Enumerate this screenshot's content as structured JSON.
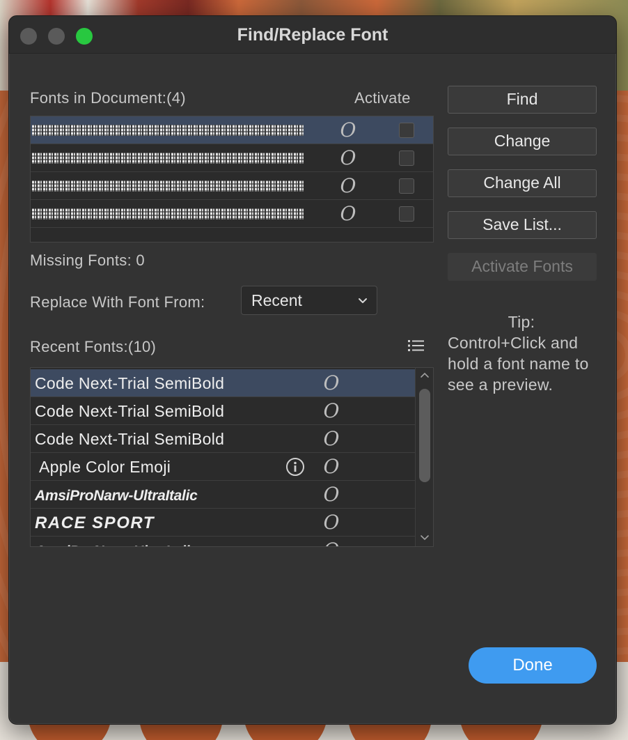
{
  "window": {
    "title": "Find/Replace Font"
  },
  "fonts_in_document": {
    "label": "Fonts in Document:(4)",
    "activate_label": "Activate",
    "rows": [
      {
        "selected": true,
        "icon": "opentype-icon",
        "checked": false
      },
      {
        "selected": false,
        "icon": "opentype-icon",
        "checked": false
      },
      {
        "selected": false,
        "icon": "opentype-icon",
        "checked": false
      },
      {
        "selected": false,
        "icon": "opentype-icon",
        "checked": false
      }
    ]
  },
  "missing_fonts": {
    "label": "Missing Fonts: 0"
  },
  "replace_with": {
    "label": "Replace With Font From:",
    "selected": "Recent"
  },
  "recent_fonts": {
    "label": "Recent Fonts:(10)",
    "rows": [
      {
        "name": "Code Next-Trial SemiBold",
        "selected": true,
        "icon": "opentype-icon"
      },
      {
        "name": "Code Next-Trial SemiBold",
        "selected": false,
        "icon": "opentype-icon"
      },
      {
        "name": "Code Next-Trial SemiBold",
        "selected": false,
        "icon": "opentype-icon"
      },
      {
        "name": "Apple Color Emoji",
        "selected": false,
        "icon": "opentype-icon",
        "info": "info-icon"
      },
      {
        "name": "AmsiProNarw-UltraItalic",
        "selected": false,
        "icon": "opentype-icon"
      },
      {
        "name": "RACE SPORT",
        "selected": false,
        "icon": "opentype-icon"
      },
      {
        "name": "AmsiProNarw-UltraItalic",
        "selected": false,
        "icon": "opentype-icon"
      }
    ]
  },
  "buttons": {
    "find": "Find",
    "change": "Change",
    "change_all": "Change All",
    "save_list": "Save List...",
    "activate_fonts": "Activate Fonts",
    "done": "Done"
  },
  "tip": {
    "head": "Tip:",
    "body": "Control+Click and hold a font name to see a preview."
  },
  "colors": {
    "window_bg": "#333333",
    "selection": "#3d4a60",
    "accent": "#3f9bf0"
  }
}
